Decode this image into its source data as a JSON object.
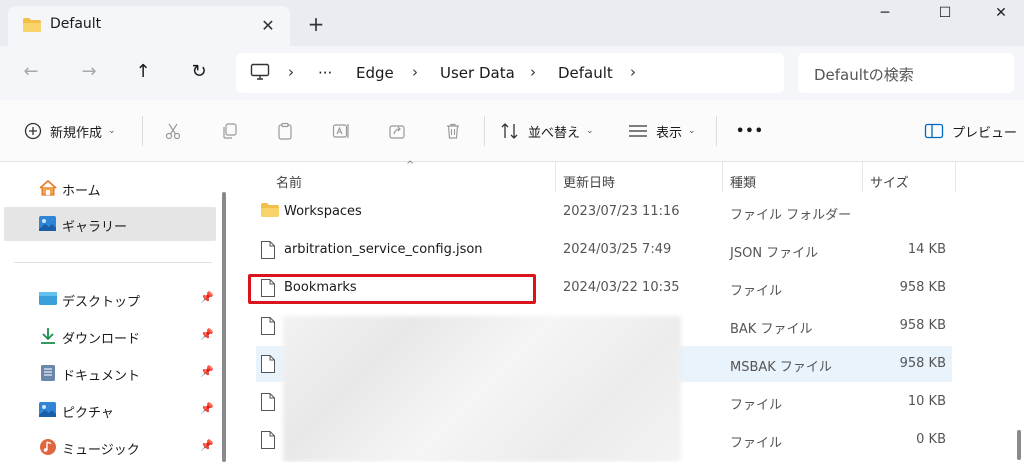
{
  "window": {
    "tab_title": "Default",
    "tab_close": "✕",
    "new_tab": "+",
    "minimize": "─",
    "maximize": "☐",
    "close": "✕"
  },
  "nav": {
    "back": "←",
    "forward": "→",
    "up": "↑",
    "refresh": "↻"
  },
  "address": {
    "more": "···",
    "crumbs": [
      "Edge",
      "User Data",
      "Default"
    ],
    "chevron": "›"
  },
  "search": {
    "placeholder": "Defaultの検索"
  },
  "toolbar": {
    "new_label": "新規作成",
    "sort_label": "並べ替え",
    "view_label": "表示",
    "more": "•••",
    "preview_label": "プレビュー",
    "caret": "⌄"
  },
  "sidebar": {
    "pin": "📌",
    "items": [
      {
        "label": "ホーム",
        "icon": "home-icon"
      },
      {
        "label": "ギャラリー",
        "icon": "gallery-icon"
      },
      {
        "label": "デスクトップ",
        "icon": "desktop-icon",
        "pinned": true
      },
      {
        "label": "ダウンロード",
        "icon": "download-icon",
        "pinned": true
      },
      {
        "label": "ドキュメント",
        "icon": "document-icon",
        "pinned": true
      },
      {
        "label": "ピクチャ",
        "icon": "picture-icon",
        "pinned": true
      },
      {
        "label": "ミュージック",
        "icon": "music-icon",
        "pinned": true
      }
    ]
  },
  "list": {
    "columns": {
      "name": "名前",
      "date": "更新日時",
      "type": "種類",
      "size": "サイズ"
    },
    "sort_indicator": "^",
    "rows": [
      {
        "name": "Workspaces",
        "date": "2023/07/23 11:16",
        "type": "ファイル フォルダー",
        "size": "",
        "kind": "folder"
      },
      {
        "name": "arbitration_service_config.json",
        "date": "2024/03/25 7:49",
        "type": "JSON ファイル",
        "size": "14 KB",
        "kind": "file"
      },
      {
        "name": "Bookmarks",
        "date": "2024/03/22 10:35",
        "type": "ファイル",
        "size": "958 KB",
        "kind": "file"
      },
      {
        "name": "",
        "date": "",
        "type": "BAK ファイル",
        "size": "958 KB",
        "kind": "file"
      },
      {
        "name": "",
        "date": "",
        "type": "MSBAK ファイル",
        "size": "958 KB",
        "kind": "file"
      },
      {
        "name": "",
        "date": "",
        "type": "ファイル",
        "size": "10 KB",
        "kind": "file"
      },
      {
        "name": "",
        "date": "",
        "type": "ファイル",
        "size": "0 KB",
        "kind": "file"
      }
    ]
  },
  "colors": {
    "highlight": "#d9141c",
    "accent": "#0067c0",
    "folder": "#f0c04a"
  }
}
